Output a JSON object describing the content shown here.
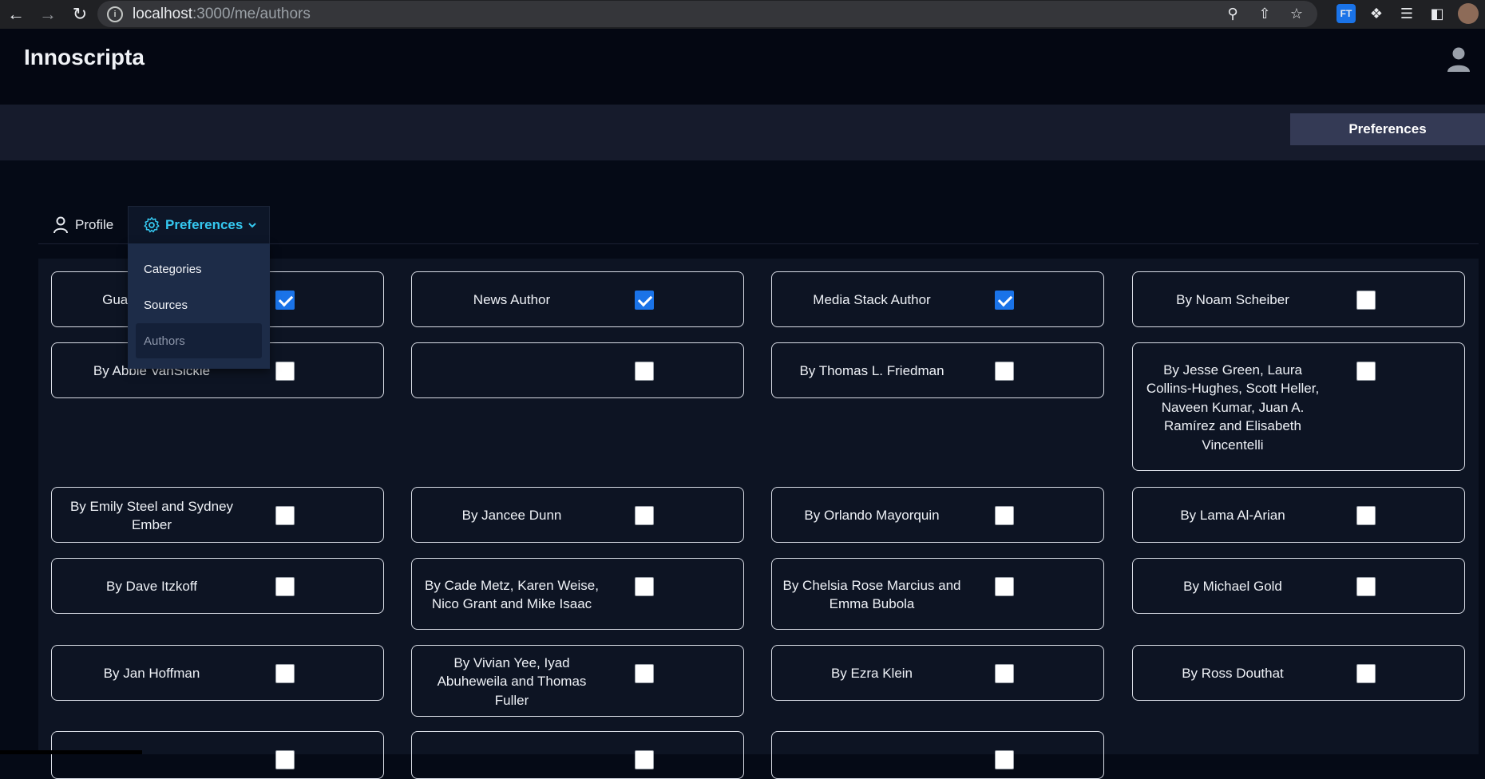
{
  "browser": {
    "url_host": "localhost",
    "url_path": ":3000/me/authors",
    "ext_badge": "FT"
  },
  "app": {
    "brand": "Innoscripta",
    "header_button": "Preferences"
  },
  "tabs": {
    "profile": "Profile",
    "preferences": "Preferences"
  },
  "dropdown": {
    "items": [
      "Categories",
      "Sources",
      "Authors"
    ],
    "active": "Authors"
  },
  "authors": [
    {
      "name": "Guardian Author",
      "checked": true
    },
    {
      "name": "News Author",
      "checked": true
    },
    {
      "name": "Media Stack Author",
      "checked": true
    },
    {
      "name": "By Noam Scheiber",
      "checked": false
    },
    {
      "name": "By Abbie VanSickle",
      "checked": false
    },
    {
      "name": "",
      "checked": false
    },
    {
      "name": "By Thomas L. Friedman",
      "checked": false
    },
    {
      "name": "By Jesse Green, Laura Collins-Hughes, Scott Heller, Naveen Kumar, Juan A. Ramírez and Elisabeth Vincentelli",
      "checked": false
    },
    {
      "name": "By Emily Steel and Sydney Ember",
      "checked": false
    },
    {
      "name": "By Jancee Dunn",
      "checked": false
    },
    {
      "name": "By Orlando Mayorquin",
      "checked": false
    },
    {
      "name": "By Lama Al-Arian",
      "checked": false
    },
    {
      "name": "By Dave Itzkoff",
      "checked": false
    },
    {
      "name": "By Cade Metz, Karen Weise, Nico Grant and Mike Isaac",
      "checked": false
    },
    {
      "name": "By Chelsia Rose Marcius and Emma Bubola",
      "checked": false
    },
    {
      "name": "By Michael Gold",
      "checked": false
    },
    {
      "name": "By Jan Hoffman",
      "checked": false
    },
    {
      "name": "By Vivian Yee, Iyad Abuheweila and Thomas Fuller",
      "checked": false
    },
    {
      "name": "By Ezra Klein",
      "checked": false
    },
    {
      "name": "By Ross Douthat",
      "checked": false
    },
    {
      "name": "",
      "checked": false
    },
    {
      "name": "",
      "checked": false
    },
    {
      "name": "",
      "checked": false
    }
  ]
}
